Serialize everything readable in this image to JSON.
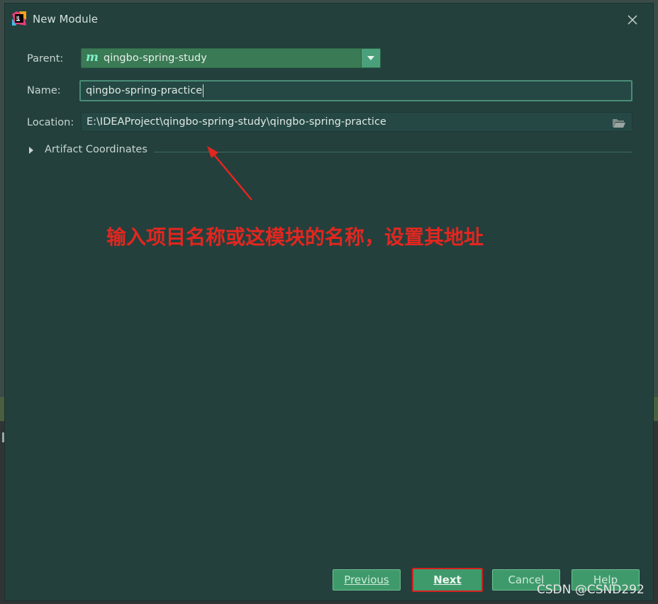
{
  "window": {
    "title": "New Module"
  },
  "form": {
    "parent_label": "Parent:",
    "parent_value": "qingbo-spring-study",
    "parent_icon": "maven-module-icon",
    "name_label": "Name:",
    "name_value": "qingbo-spring-practice",
    "location_label": "Location:",
    "location_value": "E:\\IDEAProject\\qingbo-spring-study\\qingbo-spring-practice",
    "artifact_label": "Artifact Coordinates"
  },
  "annotation": {
    "text": "输入项目名称或这模块的名称，设置其地址",
    "color": "#e3261f"
  },
  "buttons": {
    "previous": "Previous",
    "next": "Next",
    "cancel": "Cancel",
    "help": "Help"
  },
  "watermark": "CSDN @CSND292",
  "colors": {
    "dialog_bg": "#23403d",
    "accent_green": "#3f9a6b",
    "highlight_red": "#d62020"
  }
}
